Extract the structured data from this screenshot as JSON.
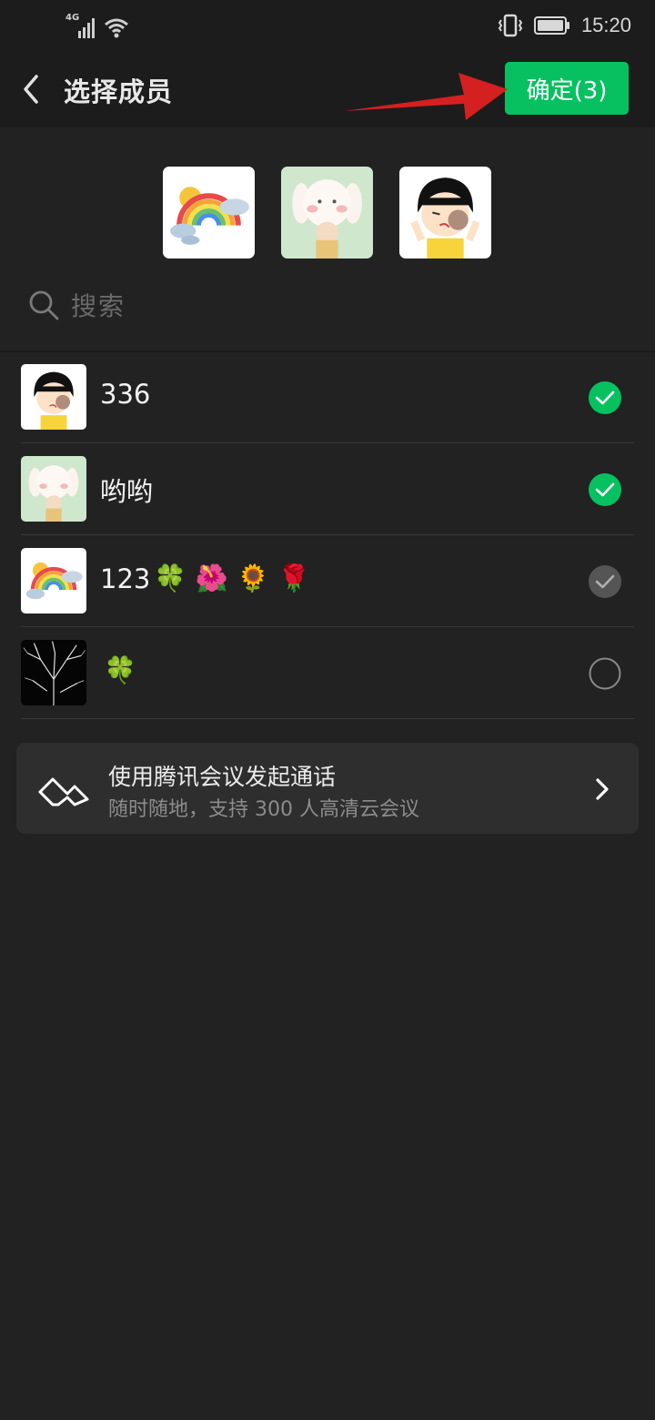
{
  "status_bar": {
    "network": "4G",
    "time": "15:20"
  },
  "header": {
    "title": "选择成员",
    "confirm_label": "确定(3)"
  },
  "selected_avatars": [
    {
      "name": "123",
      "avatar": "rainbow"
    },
    {
      "name": "哟哟",
      "avatar": "bunny-girl"
    },
    {
      "name": "336",
      "avatar": "cartoon-girl"
    }
  ],
  "search": {
    "placeholder": "搜索"
  },
  "contacts": [
    {
      "name": "336",
      "emojis": "",
      "avatar": "cartoon-girl",
      "state": "selected"
    },
    {
      "name": "哟哟",
      "emojis": "",
      "avatar": "bunny-girl",
      "state": "selected"
    },
    {
      "name": "123",
      "emojis": "🍀 🌺 🌻 🌹",
      "avatar": "rainbow",
      "state": "preselected"
    },
    {
      "name": "",
      "emojis": "🍀",
      "avatar": "tree-branches",
      "state": "unselected"
    }
  ],
  "meeting_card": {
    "title": "使用腾讯会议发起通话",
    "subtitle": "随时随地，支持 300 人高清云会议"
  },
  "colors": {
    "accent_green": "#07c160",
    "background": "#222222",
    "header": "#1c1c1c",
    "annotation_arrow": "#d42020"
  }
}
